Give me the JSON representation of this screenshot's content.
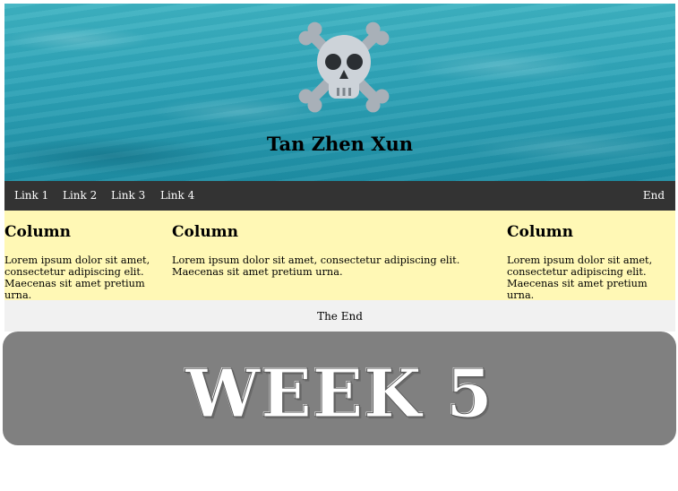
{
  "header": {
    "title": "Tan Zhen Xun",
    "logo_icon": "skull-and-crossbones-icon",
    "background": "ocean-water"
  },
  "nav": {
    "links": [
      "Link 1",
      "Link 2",
      "Link 3",
      "Link 4"
    ],
    "right_link": "End"
  },
  "columns": [
    {
      "heading": "Column",
      "text": "Lorem ipsum dolor sit amet, consectetur adipiscing elit. Maecenas sit amet pretium urna."
    },
    {
      "heading": "Column",
      "text": "Lorem ipsum dolor sit amet, consectetur adipiscing elit. Maecenas sit amet pretium urna."
    },
    {
      "heading": "Column",
      "text": "Lorem ipsum dolor sit amet, consectetur adipiscing elit. Maecenas sit amet pretium urna."
    }
  ],
  "footer": {
    "text": "The End"
  },
  "banner": {
    "text": "WEEK 5"
  },
  "colors": {
    "nav_bg": "#333333",
    "columns_bg": "#fff8b5",
    "footer_bg": "#f1f1f1",
    "banner_bg": "#808080"
  }
}
